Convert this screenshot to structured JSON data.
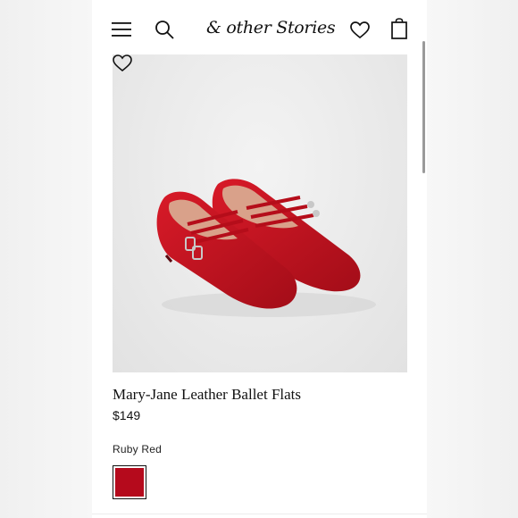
{
  "header": {
    "logo_text": "& other Stories",
    "icons": [
      "menu-icon",
      "search-icon",
      "heart-icon",
      "shopping-bag-icon"
    ]
  },
  "product": {
    "title": "Mary-Jane Leather Ballet Flats",
    "price": "$149",
    "color_name": "Ruby Red",
    "swatch_color": "#b50a1c",
    "image_icon": "wishlist-heart-icon"
  },
  "colors": {
    "shoe": "#c8101f",
    "shoe_dark": "#8e0a14",
    "lining": "#d9a18a",
    "text": "#111111"
  }
}
